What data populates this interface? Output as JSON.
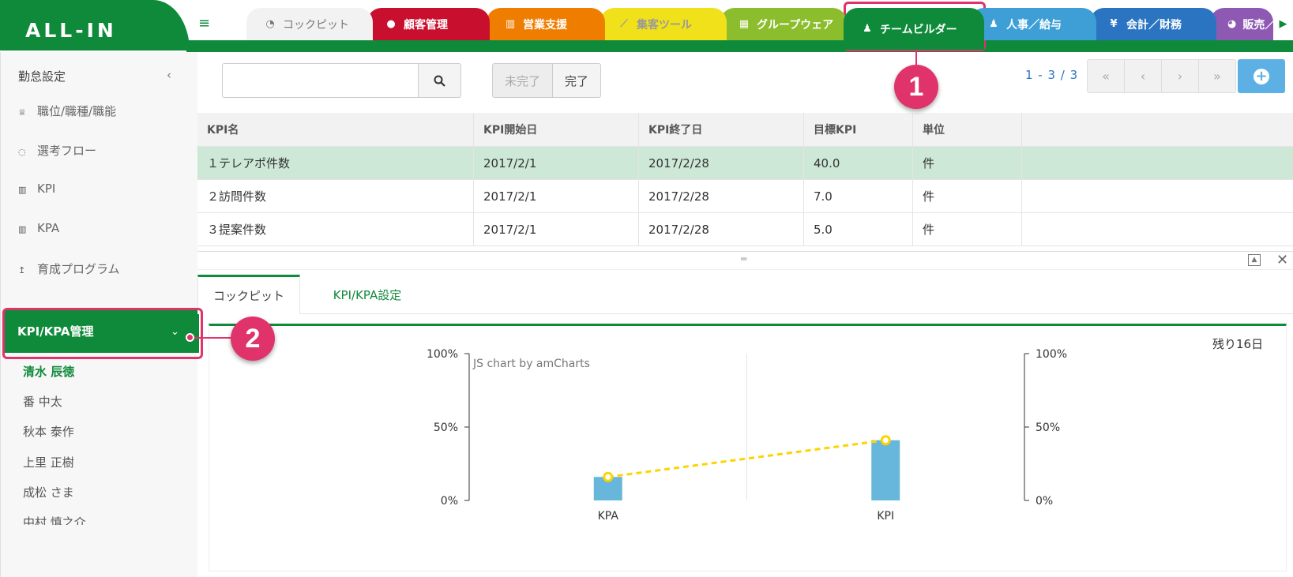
{
  "app": {
    "logo": "ALL-IN"
  },
  "tabs": [
    {
      "icon": "dashboard-icon",
      "glyph": "◔",
      "label": "コックピット"
    },
    {
      "icon": "comments-icon",
      "glyph": "●",
      "label": "顧客管理"
    },
    {
      "icon": "bar-chart-icon",
      "glyph": "▥",
      "label": "営業支援"
    },
    {
      "icon": "line-chart-icon",
      "glyph": "⟋",
      "label": "集客ツール"
    },
    {
      "icon": "calendar-icon",
      "glyph": "▦",
      "label": "グループウェア"
    },
    {
      "icon": "user-plus-icon",
      "glyph": "♟",
      "label": "チームビルダー"
    },
    {
      "icon": "users-icon",
      "glyph": "♟",
      "label": "人事／給与"
    },
    {
      "icon": "yen-icon",
      "glyph": "¥",
      "label": "会計／財務"
    },
    {
      "icon": "pie-chart-icon",
      "glyph": "◕",
      "label": "販売／"
    }
  ],
  "sidebar": {
    "header": "勤怠設定",
    "items": [
      {
        "icon": "trophy-icon",
        "glyph": "♕",
        "label": "職位/職種/職能"
      },
      {
        "icon": "comment-icon",
        "glyph": "◌",
        "label": "選考フロー"
      },
      {
        "icon": "bar-chart-icon",
        "glyph": "▥",
        "label": "KPI"
      },
      {
        "icon": "bar-chart-icon",
        "glyph": "▥",
        "label": "KPA"
      },
      {
        "icon": "upload-icon",
        "glyph": "↥",
        "label": "育成プログラム"
      }
    ],
    "active_section": "KPI/KPA管理",
    "people": [
      "清水 辰徳",
      "番 中太",
      "秋本 泰作",
      "上里 正樹",
      "成松 さま",
      "中村 慎之介"
    ]
  },
  "toolbar": {
    "search_value": "",
    "filter_incomplete": "未完了",
    "filter_complete": "完了",
    "page_range": "1 - 3 / 3",
    "pg_first": "«",
    "pg_prev": "‹",
    "pg_next": "›",
    "pg_last": "»",
    "add": "+"
  },
  "table": {
    "headers": [
      "KPI名",
      "KPI開始日",
      "KPI終了日",
      "目標KPI",
      "単位",
      ""
    ],
    "rows": [
      [
        "１テレアポ件数",
        "2017/2/1",
        "2017/2/28",
        "40.0",
        "件",
        ""
      ],
      [
        "２訪問件数",
        "2017/2/1",
        "2017/2/28",
        "7.0",
        "件",
        ""
      ],
      [
        "３提案件数",
        "2017/2/1",
        "2017/2/28",
        "5.0",
        "件",
        ""
      ]
    ],
    "selected_row": 0
  },
  "bottom_panel": {
    "tabs": [
      "コックピット",
      "KPI/KPA設定"
    ],
    "active_tab": 0,
    "remaining": "残り16日"
  },
  "chart_data": {
    "type": "bar",
    "credit": "JS chart by amCharts",
    "categories": [
      "KPA",
      "KPI"
    ],
    "series": [
      {
        "type": "bar",
        "values": [
          16,
          41
        ],
        "color": "#67b7dc"
      },
      {
        "type": "line",
        "values": [
          16,
          41
        ],
        "color": "#fdd400",
        "style": "dashed"
      }
    ],
    "ylim": [
      0,
      100
    ],
    "yticks": [
      "0%",
      "50%",
      "100%"
    ],
    "y2ticks": [
      "0%",
      "50%",
      "100%"
    ]
  },
  "annotations": [
    {
      "number": "1"
    },
    {
      "number": "2"
    }
  ],
  "colors": {
    "brand_green": "#0f8a3a",
    "highlight": "#e0336b",
    "selected_row": "#cde8d7"
  }
}
